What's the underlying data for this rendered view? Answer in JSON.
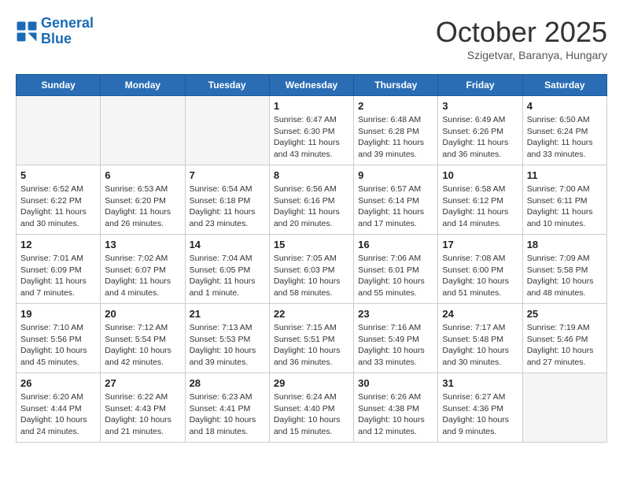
{
  "logo": {
    "line1": "General",
    "line2": "Blue"
  },
  "title": "October 2025",
  "subtitle": "Szigetvar, Baranya, Hungary",
  "days_of_week": [
    "Sunday",
    "Monday",
    "Tuesday",
    "Wednesday",
    "Thursday",
    "Friday",
    "Saturday"
  ],
  "weeks": [
    [
      {
        "num": "",
        "info": "",
        "empty": true
      },
      {
        "num": "",
        "info": "",
        "empty": true
      },
      {
        "num": "",
        "info": "",
        "empty": true
      },
      {
        "num": "1",
        "info": "Sunrise: 6:47 AM\nSunset: 6:30 PM\nDaylight: 11 hours\nand 43 minutes."
      },
      {
        "num": "2",
        "info": "Sunrise: 6:48 AM\nSunset: 6:28 PM\nDaylight: 11 hours\nand 39 minutes."
      },
      {
        "num": "3",
        "info": "Sunrise: 6:49 AM\nSunset: 6:26 PM\nDaylight: 11 hours\nand 36 minutes."
      },
      {
        "num": "4",
        "info": "Sunrise: 6:50 AM\nSunset: 6:24 PM\nDaylight: 11 hours\nand 33 minutes."
      }
    ],
    [
      {
        "num": "5",
        "info": "Sunrise: 6:52 AM\nSunset: 6:22 PM\nDaylight: 11 hours\nand 30 minutes."
      },
      {
        "num": "6",
        "info": "Sunrise: 6:53 AM\nSunset: 6:20 PM\nDaylight: 11 hours\nand 26 minutes."
      },
      {
        "num": "7",
        "info": "Sunrise: 6:54 AM\nSunset: 6:18 PM\nDaylight: 11 hours\nand 23 minutes."
      },
      {
        "num": "8",
        "info": "Sunrise: 6:56 AM\nSunset: 6:16 PM\nDaylight: 11 hours\nand 20 minutes."
      },
      {
        "num": "9",
        "info": "Sunrise: 6:57 AM\nSunset: 6:14 PM\nDaylight: 11 hours\nand 17 minutes."
      },
      {
        "num": "10",
        "info": "Sunrise: 6:58 AM\nSunset: 6:12 PM\nDaylight: 11 hours\nand 14 minutes."
      },
      {
        "num": "11",
        "info": "Sunrise: 7:00 AM\nSunset: 6:11 PM\nDaylight: 11 hours\nand 10 minutes."
      }
    ],
    [
      {
        "num": "12",
        "info": "Sunrise: 7:01 AM\nSunset: 6:09 PM\nDaylight: 11 hours\nand 7 minutes."
      },
      {
        "num": "13",
        "info": "Sunrise: 7:02 AM\nSunset: 6:07 PM\nDaylight: 11 hours\nand 4 minutes."
      },
      {
        "num": "14",
        "info": "Sunrise: 7:04 AM\nSunset: 6:05 PM\nDaylight: 11 hours\nand 1 minute."
      },
      {
        "num": "15",
        "info": "Sunrise: 7:05 AM\nSunset: 6:03 PM\nDaylight: 10 hours\nand 58 minutes."
      },
      {
        "num": "16",
        "info": "Sunrise: 7:06 AM\nSunset: 6:01 PM\nDaylight: 10 hours\nand 55 minutes."
      },
      {
        "num": "17",
        "info": "Sunrise: 7:08 AM\nSunset: 6:00 PM\nDaylight: 10 hours\nand 51 minutes."
      },
      {
        "num": "18",
        "info": "Sunrise: 7:09 AM\nSunset: 5:58 PM\nDaylight: 10 hours\nand 48 minutes."
      }
    ],
    [
      {
        "num": "19",
        "info": "Sunrise: 7:10 AM\nSunset: 5:56 PM\nDaylight: 10 hours\nand 45 minutes."
      },
      {
        "num": "20",
        "info": "Sunrise: 7:12 AM\nSunset: 5:54 PM\nDaylight: 10 hours\nand 42 minutes."
      },
      {
        "num": "21",
        "info": "Sunrise: 7:13 AM\nSunset: 5:53 PM\nDaylight: 10 hours\nand 39 minutes."
      },
      {
        "num": "22",
        "info": "Sunrise: 7:15 AM\nSunset: 5:51 PM\nDaylight: 10 hours\nand 36 minutes."
      },
      {
        "num": "23",
        "info": "Sunrise: 7:16 AM\nSunset: 5:49 PM\nDaylight: 10 hours\nand 33 minutes."
      },
      {
        "num": "24",
        "info": "Sunrise: 7:17 AM\nSunset: 5:48 PM\nDaylight: 10 hours\nand 30 minutes."
      },
      {
        "num": "25",
        "info": "Sunrise: 7:19 AM\nSunset: 5:46 PM\nDaylight: 10 hours\nand 27 minutes."
      }
    ],
    [
      {
        "num": "26",
        "info": "Sunrise: 6:20 AM\nSunset: 4:44 PM\nDaylight: 10 hours\nand 24 minutes."
      },
      {
        "num": "27",
        "info": "Sunrise: 6:22 AM\nSunset: 4:43 PM\nDaylight: 10 hours\nand 21 minutes."
      },
      {
        "num": "28",
        "info": "Sunrise: 6:23 AM\nSunset: 4:41 PM\nDaylight: 10 hours\nand 18 minutes."
      },
      {
        "num": "29",
        "info": "Sunrise: 6:24 AM\nSunset: 4:40 PM\nDaylight: 10 hours\nand 15 minutes."
      },
      {
        "num": "30",
        "info": "Sunrise: 6:26 AM\nSunset: 4:38 PM\nDaylight: 10 hours\nand 12 minutes."
      },
      {
        "num": "31",
        "info": "Sunrise: 6:27 AM\nSunset: 4:36 PM\nDaylight: 10 hours\nand 9 minutes."
      },
      {
        "num": "",
        "info": "",
        "empty": true
      }
    ]
  ]
}
